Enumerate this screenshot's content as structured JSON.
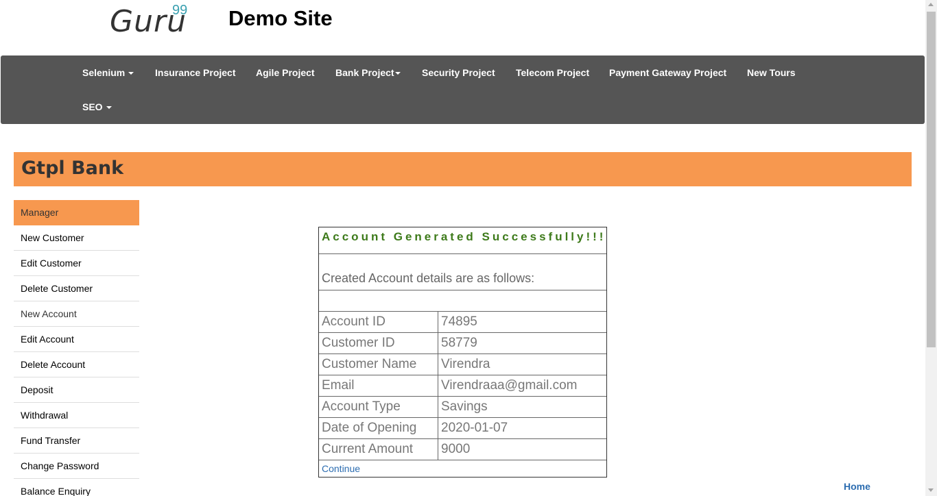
{
  "header": {
    "logo_text": "Guru",
    "logo_sup": "99",
    "site_title": "Demo Site"
  },
  "navbar": {
    "items": [
      {
        "label": "Selenium",
        "dropdown": true
      },
      {
        "label": "Insurance Project",
        "dropdown": false
      },
      {
        "label": "Agile Project",
        "dropdown": false
      },
      {
        "label": "Bank Project",
        "dropdown": true
      },
      {
        "label": "Security Project",
        "dropdown": false
      },
      {
        "label": "Telecom Project",
        "dropdown": false
      },
      {
        "label": "Payment Gateway Project",
        "dropdown": false
      },
      {
        "label": "New Tours",
        "dropdown": false
      },
      {
        "label": "SEO",
        "dropdown": true
      }
    ]
  },
  "bank": {
    "title": "Gtpl Bank"
  },
  "sidebar": {
    "items": [
      {
        "label": "Manager",
        "active": true
      },
      {
        "label": "New Customer"
      },
      {
        "label": "Edit Customer"
      },
      {
        "label": "Delete Customer"
      },
      {
        "label": "New Account"
      },
      {
        "label": "Edit Account"
      },
      {
        "label": "Delete Account"
      },
      {
        "label": "Deposit"
      },
      {
        "label": "Withdrawal"
      },
      {
        "label": "Fund Transfer"
      },
      {
        "label": "Change Password"
      },
      {
        "label": "Balance Enquiry"
      }
    ]
  },
  "account": {
    "success_message": "Account Generated Successfully!!!",
    "details_heading": "Created Account details are as follows:",
    "rows": [
      {
        "key": "Account ID",
        "value": "74895"
      },
      {
        "key": "Customer ID",
        "value": "58779"
      },
      {
        "key": "Customer Name",
        "value": "Virendra"
      },
      {
        "key": "Email",
        "value": "Virendraaa@gmail.com"
      },
      {
        "key": "Account Type",
        "value": "Savings"
      },
      {
        "key": "Date of Opening",
        "value": "2020-01-07"
      },
      {
        "key": "Current Amount",
        "value": "9000"
      }
    ],
    "continue_label": "Continue"
  },
  "footer": {
    "home_label": "Home"
  },
  "colors": {
    "navbar_bg": "#555555",
    "accent_orange": "#f7984f",
    "success_green": "#3d7a1a",
    "link_blue": "#2b6cb0"
  }
}
